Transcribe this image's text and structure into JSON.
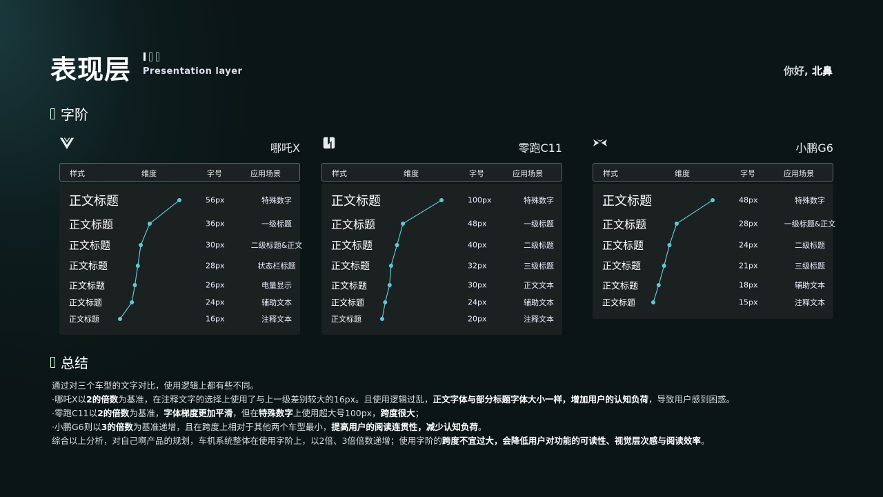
{
  "header": {
    "title": "表现层",
    "subtitle": "Presentation layer",
    "greeting_prefix": "你好,",
    "greeting_name": "北鼻"
  },
  "sections": {
    "type_scale": "字阶",
    "summary": "总结"
  },
  "table_headers": {
    "style": "样式",
    "dimension": "维度",
    "size": "字号",
    "usage": "应用场景"
  },
  "sample_text": "正文标题",
  "panels": [
    {
      "name": "哪吒X",
      "logo_icon": "neta-logo-icon",
      "rows": [
        {
          "size": "56px",
          "usage": "特殊数字"
        },
        {
          "size": "36px",
          "usage": "一级标题"
        },
        {
          "size": "30px",
          "usage": "二级标题&正文"
        },
        {
          "size": "28px",
          "usage": "状态栏标题"
        },
        {
          "size": "26px",
          "usage": "电量显示"
        },
        {
          "size": "24px",
          "usage": "辅助文本"
        },
        {
          "size": "16px",
          "usage": "注释文本"
        }
      ],
      "sizes": [
        56,
        36,
        30,
        28,
        26,
        24,
        16
      ]
    },
    {
      "name": "零跑C11",
      "logo_icon": "leapmotor-logo-icon",
      "rows": [
        {
          "size": "100px",
          "usage": "特殊数字"
        },
        {
          "size": "48px",
          "usage": "一级标题"
        },
        {
          "size": "40px",
          "usage": "二级标题"
        },
        {
          "size": "32px",
          "usage": "三级标题"
        },
        {
          "size": "30px",
          "usage": "正文文本"
        },
        {
          "size": "24px",
          "usage": "辅助文本"
        },
        {
          "size": "20px",
          "usage": "注释文本"
        }
      ],
      "sizes": [
        100,
        48,
        40,
        32,
        30,
        24,
        20
      ]
    },
    {
      "name": "小鹏G6",
      "logo_icon": "xpeng-logo-icon",
      "rows": [
        {
          "size": "48px",
          "usage": "特殊数字"
        },
        {
          "size": "28px",
          "usage": "一级标题&正文"
        },
        {
          "size": "24px",
          "usage": "二级标题"
        },
        {
          "size": "21px",
          "usage": "三级标题"
        },
        {
          "size": "18px",
          "usage": "辅助文本"
        },
        {
          "size": "15px",
          "usage": "注释文本"
        }
      ],
      "sizes": [
        48,
        28,
        24,
        21,
        18,
        15
      ]
    }
  ],
  "summary": {
    "intro": "通过对三个车型的文字对比，使用逻辑上都有些不同。",
    "line1": [
      "·哪吒X以",
      "2的倍数",
      "为基准，在注释文字的选择上使用了与上一级差别较大的16px。且使用逻辑过乱，",
      "正文字体与部分标题字体大小一样，增加用户的认知负荷",
      "，导致用户感到困惑。"
    ],
    "line2": [
      "·零跑C11以",
      "2的倍数",
      "为基准，",
      "字体梯度更加平滑",
      "，但在",
      "特殊数字",
      "上使用超大号100px，",
      "跨度很大",
      "；"
    ],
    "line3": [
      "·小鹏G6则以",
      "3的倍数",
      "为基准递增，且在跨度上相对于其他两个车型最小，",
      "提高用户的阅读连贯性，减少认知负荷",
      "。"
    ],
    "line4": [
      "综合以上分析，对自己啊产品的规划，车机系统整体在使用字阶上，以2倍、3倍倍数递增；使用字阶的",
      "跨度不宜过大，会降低用户对功能的可读性、视觉层次感与阅读效率",
      "。"
    ]
  },
  "colors": {
    "background": "#0b1516",
    "panel": "#1b2021",
    "accent": "#5fc8d8"
  }
}
